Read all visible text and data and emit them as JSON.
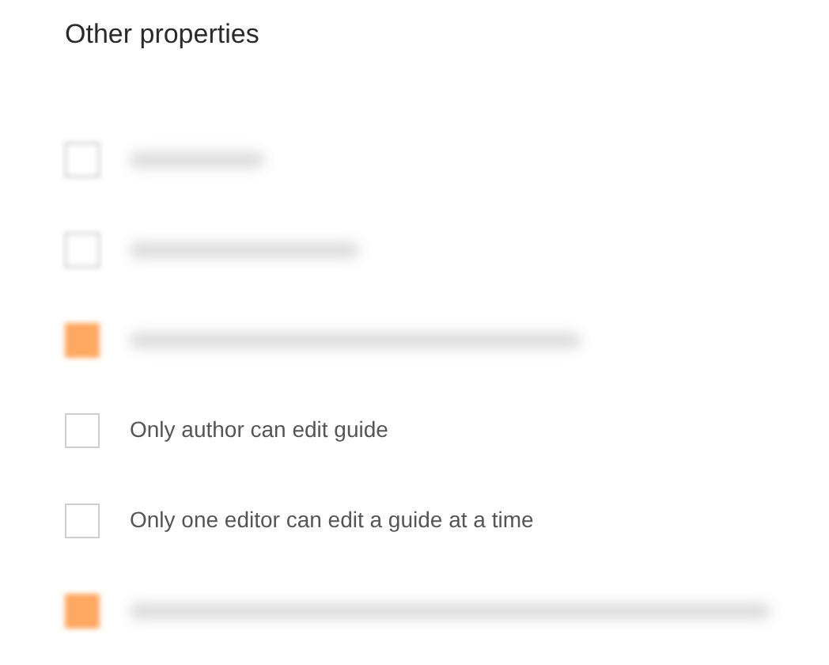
{
  "section": {
    "title": "Other properties"
  },
  "options": [
    {
      "kind": "blurred",
      "checked": false
    },
    {
      "kind": "blurred",
      "checked": false
    },
    {
      "kind": "blurred",
      "checked": true
    },
    {
      "kind": "plain",
      "label": "Only author can edit guide",
      "checked": false
    },
    {
      "kind": "plain",
      "label": "Only one editor can edit a guide at a time",
      "checked": false
    },
    {
      "kind": "blurred",
      "checked": true
    }
  ]
}
